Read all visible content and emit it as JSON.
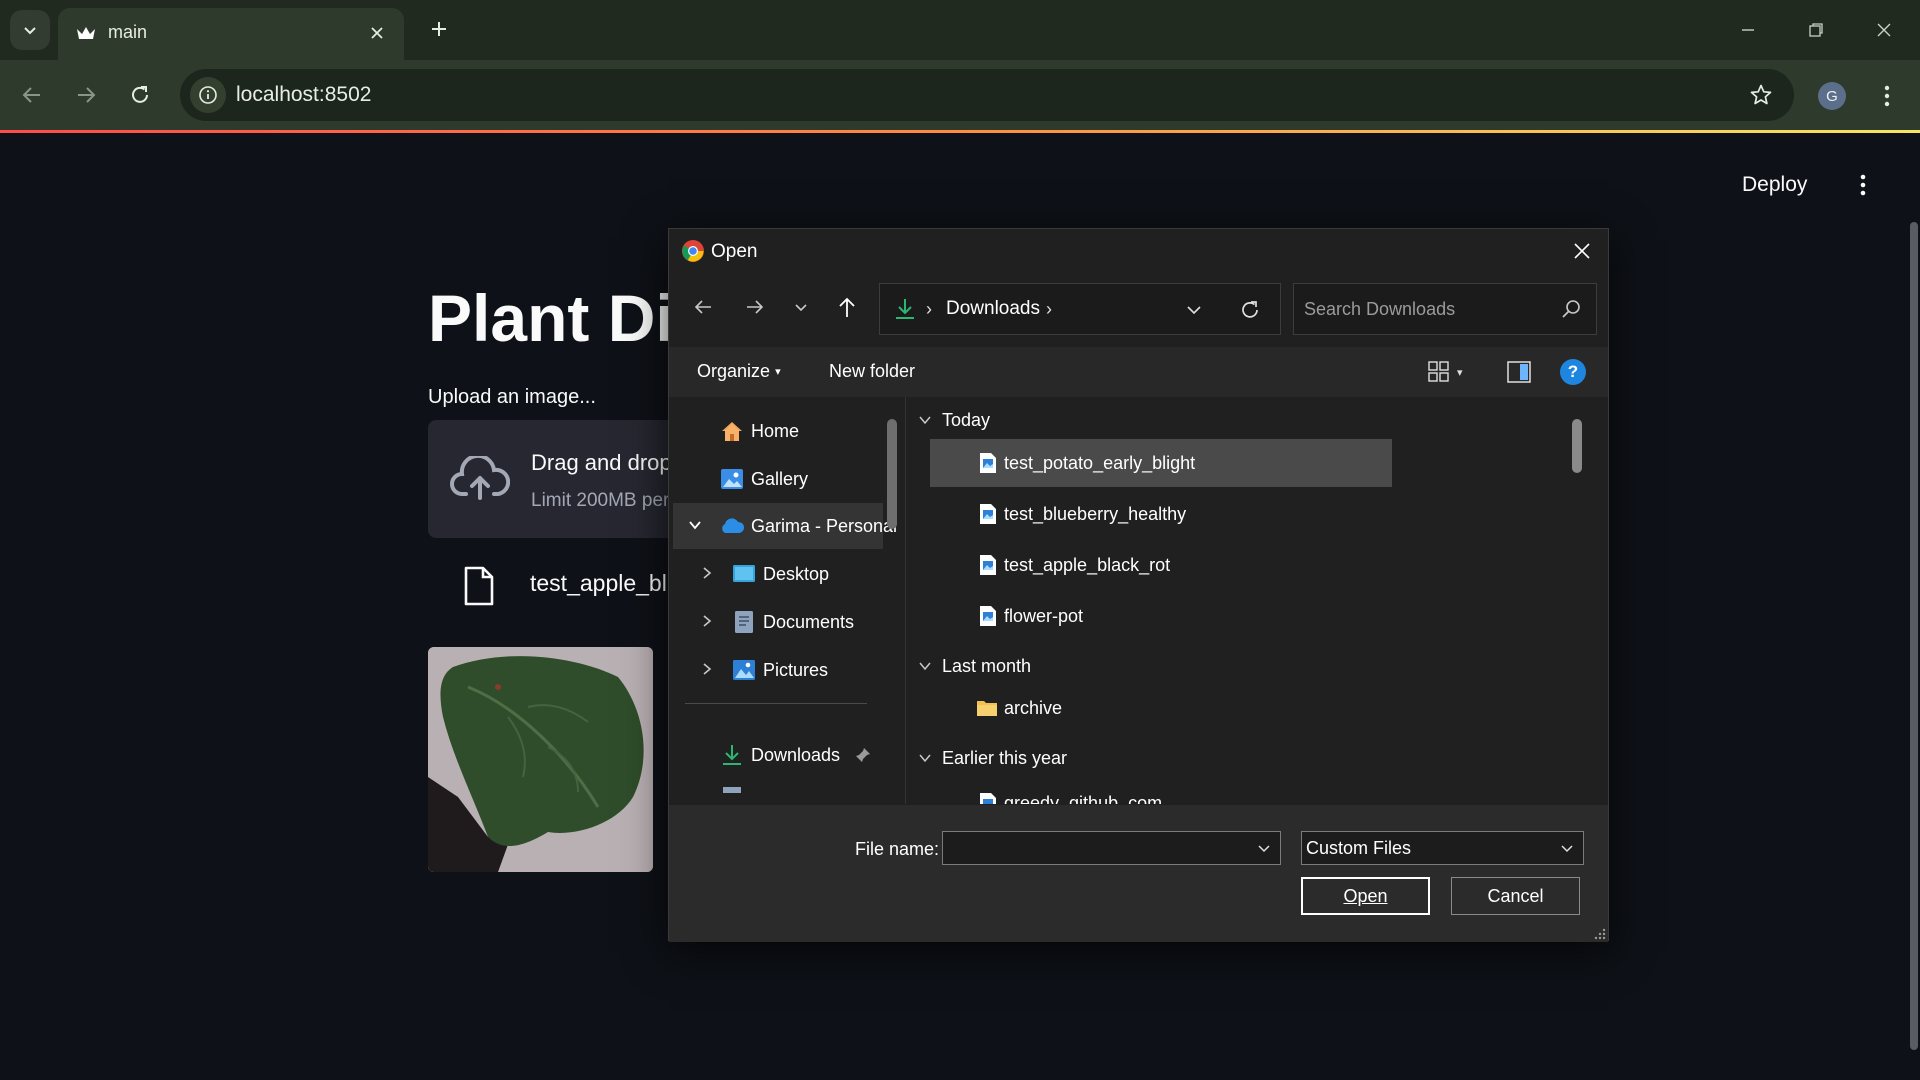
{
  "browser": {
    "tab_title": "main",
    "url": "localhost:8502",
    "profile_initial": "G"
  },
  "app": {
    "deploy_label": "Deploy",
    "title": "Plant Dis",
    "upload_label": "Upload an image...",
    "dropzone_title": "Drag and drop",
    "dropzone_limit": "Limit 200MB per",
    "uploaded_file": "test_apple_bl"
  },
  "dialog": {
    "title": "Open",
    "address": "Downloads",
    "search_placeholder": "Search Downloads",
    "organize_label": "Organize",
    "new_folder_label": "New folder",
    "help_label": "?",
    "nav_items": {
      "home": "Home",
      "gallery": "Gallery",
      "onedrive": "Garima - Personal",
      "desktop": "Desktop",
      "documents": "Documents",
      "pictures": "Pictures",
      "downloads": "Downloads"
    },
    "groups": {
      "today": "Today",
      "last_month": "Last month",
      "earlier": "Earlier this year"
    },
    "files_today": [
      "test_potato_early_blight",
      "test_blueberry_healthy",
      "test_apple_black_rot",
      "flower-pot"
    ],
    "files_last_month": [
      "archive"
    ],
    "files_earlier": [
      "greedy_github_com"
    ],
    "file_name_label": "File name:",
    "file_name_value": "",
    "file_type": "Custom Files",
    "open_label": "Open",
    "cancel_label": "Cancel"
  },
  "colors": {
    "browser_frame": "#2e3b2c",
    "page_bg": "#0e1117",
    "accent_help": "#1e86e0",
    "download_green": "#2bb673"
  }
}
